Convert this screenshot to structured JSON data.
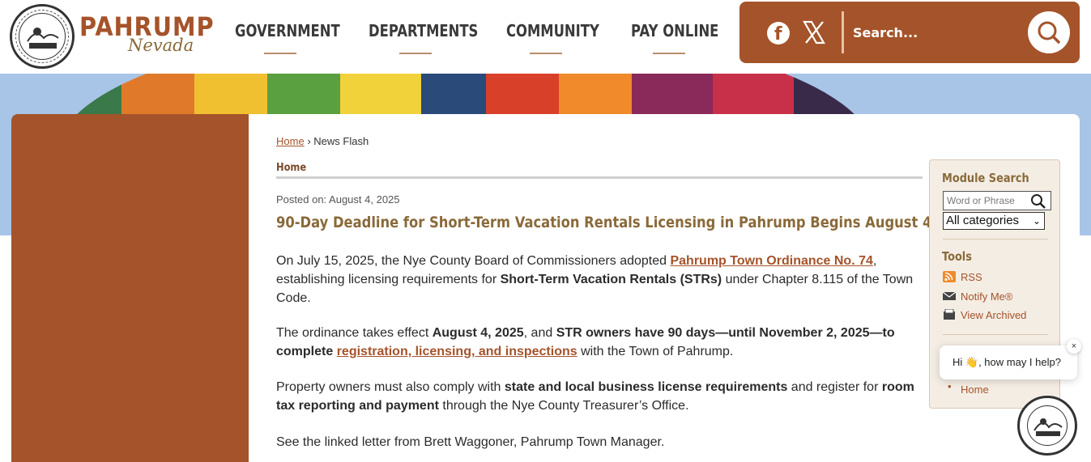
{
  "header": {
    "brand_top": "PAHRUMP",
    "brand_sub": "Nevada",
    "nav": [
      {
        "label": "GOVERNMENT"
      },
      {
        "label": "DEPARTMENTS"
      },
      {
        "label": "COMMUNITY"
      },
      {
        "label": "PAY ONLINE"
      }
    ],
    "search_placeholder": "Search...",
    "social": [
      "facebook-icon",
      "x-icon"
    ],
    "accent_color": "#a5532a"
  },
  "breadcrumb": {
    "home": "Home",
    "sep": "›",
    "current": "News Flash"
  },
  "section_title": "Home",
  "article": {
    "posted": "Posted on: August 4, 2025",
    "title": "90-Day Deadline for Short-Term Vacation Rentals Licensing in Pahrump Begins August 4",
    "p1_a": "On July 15, 2025, the Nye County Board of Commissioners adopted ",
    "p1_link": "Pahrump Town Ordinance No. 74",
    "p1_b": ", establishing licensing requirements for ",
    "p1_bold": "Short-Term Vacation Rentals (STRs)",
    "p1_c": " under Chapter 8.115 of the Town Code.",
    "p2_a": "The ordinance takes effect ",
    "p2_bold1": "August 4, 2025",
    "p2_b": ", and ",
    "p2_bold2": "STR owners have 90 days—until November 2, 2025—to complete",
    "p2_c": " ",
    "p2_link": "registration, licensing, and inspections",
    "p2_d": " with the Town of Pahrump.",
    "p3_a": "Property owners must also comply with ",
    "p3_bold1": "state and local business license requirements",
    "p3_b": " and register for ",
    "p3_bold2": "room tax reporting and payment",
    "p3_c": " through the Nye County Treasurer’s Office.",
    "p4": "See the linked letter from Brett Waggoner, Pahrump Town Manager."
  },
  "sidebar": {
    "module_search_title": "Module Search",
    "search_placeholder": "Word or Phrase",
    "category_selected": "All categories",
    "tools_title": "Tools",
    "tools": [
      {
        "label": "RSS",
        "icon": "rss-icon"
      },
      {
        "label": "Notify Me®",
        "icon": "mail-icon"
      },
      {
        "label": "View Archived",
        "icon": "archive-icon"
      }
    ],
    "bottom_link": "Home"
  },
  "chat": {
    "greeting_a": "Hi ",
    "emoji": "👋",
    "greeting_b": ", how may I help?",
    "close": "×"
  }
}
